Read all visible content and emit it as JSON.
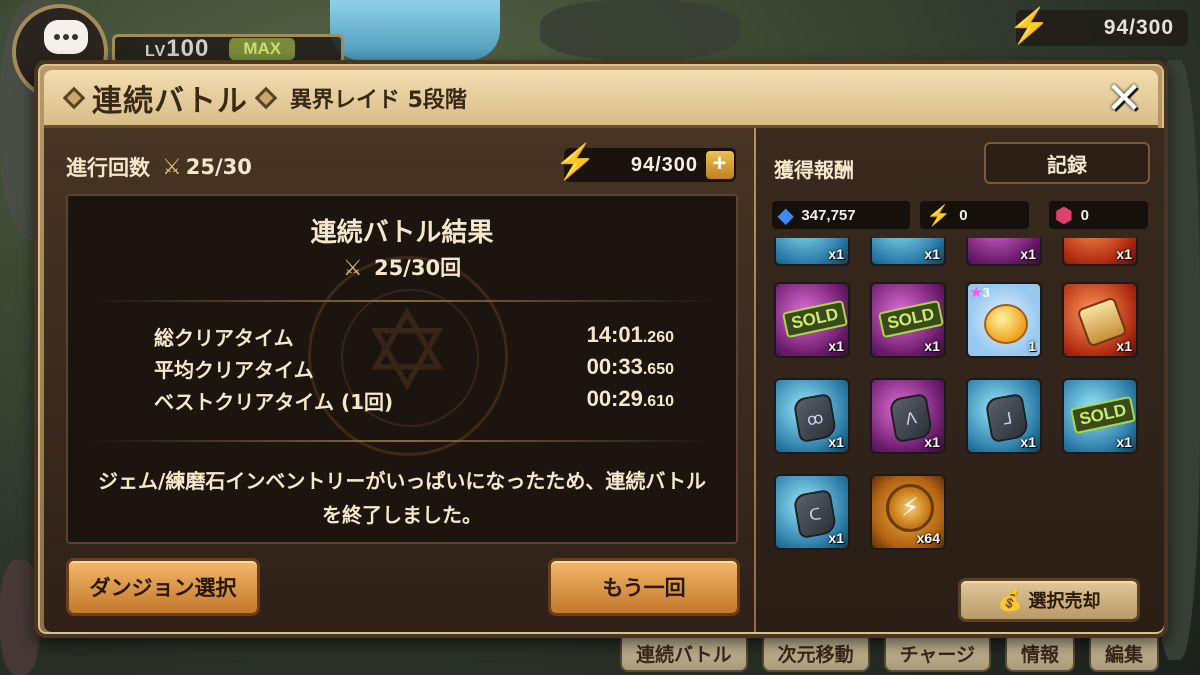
{
  "hud": {
    "level_prefix": "LV",
    "level": "100",
    "level_badge": "MAX",
    "energy": "94/300"
  },
  "bottom_tabs": [
    "連続バトル",
    "次元移動",
    "チャージ",
    "情報",
    "編集"
  ],
  "dialog": {
    "title": "連続バトル",
    "subtitle": "異界レイド 5段階",
    "close_label": "✕"
  },
  "progress": {
    "label": "進行回数",
    "value": "25/30",
    "energy": "94/300"
  },
  "result": {
    "title": "連続バトル結果",
    "count": "25/30回",
    "times": [
      {
        "label": "総クリアタイム",
        "value_main": "14:01",
        "value_ms": ".260"
      },
      {
        "label": "平均クリアタイム",
        "value_main": "00:33",
        "value_ms": ".650"
      },
      {
        "label": "ベストクリアタイム (1回)",
        "value_main": "00:29",
        "value_ms": ".610"
      }
    ],
    "message": "ジェム/練磨石インベントリーがいっぱいになったため、連続バトルを終了しました。"
  },
  "buttons": {
    "dungeon_select": "ダンジョン選択",
    "retry": "もう一回",
    "record": "記録",
    "sell_selected": "選択売却"
  },
  "rewards": {
    "label": "獲得報酬",
    "crystals": "347,757",
    "energy_gained": "0",
    "mana_stones": "0",
    "items": [
      {
        "color": "blue",
        "kind": "rune",
        "qty": "x1",
        "partial": true
      },
      {
        "color": "blue",
        "kind": "rune",
        "qty": "x1",
        "partial": true
      },
      {
        "color": "purple",
        "kind": "rune",
        "qty": "x1",
        "partial": true
      },
      {
        "color": "red",
        "kind": "rune",
        "qty": "x1",
        "partial": true
      },
      {
        "color": "purple",
        "kind": "sold",
        "qty": "x1",
        "sold_label": "SOLD"
      },
      {
        "color": "purple",
        "kind": "sold",
        "qty": "x1",
        "sold_label": "SOLD"
      },
      {
        "color": "blue",
        "kind": "monster",
        "qty": "1",
        "stars": "3"
      },
      {
        "color": "red",
        "kind": "scroll",
        "qty": "x1"
      },
      {
        "color": "blue",
        "kind": "rune",
        "qty": "x1",
        "glyph": "ꝏ"
      },
      {
        "color": "purple",
        "kind": "rune",
        "qty": "x1",
        "glyph": "ᐱ"
      },
      {
        "color": "blue",
        "kind": "rune",
        "qty": "x1",
        "glyph": "ᒧ"
      },
      {
        "color": "blue",
        "kind": "sold",
        "qty": "x1",
        "sold_label": "SOLD"
      },
      {
        "color": "blue",
        "kind": "rune",
        "qty": "x1",
        "glyph": "ᑕ"
      },
      {
        "color": "orange",
        "kind": "coin",
        "qty": "x64"
      }
    ]
  },
  "colors": {
    "panel_dark": "#2f2118",
    "button_orange": "#e0a050",
    "energy_bolt": "#f2c23a",
    "sold_green": "#a8d848"
  }
}
